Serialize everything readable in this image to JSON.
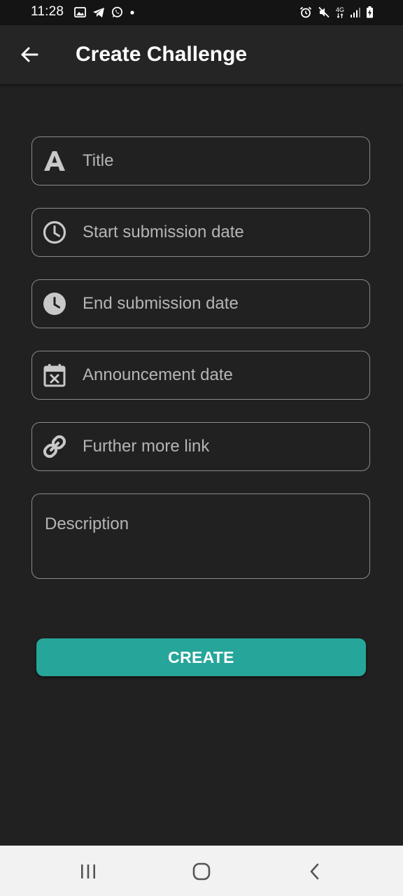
{
  "status_bar": {
    "time": "11:28",
    "left_icons": [
      "gallery-icon",
      "telegram-icon",
      "whatsapp-icon",
      "dot-icon"
    ],
    "network_label_top": "4G",
    "right_icons": [
      "alarm-icon",
      "mute-icon",
      "network-4g-icon",
      "signal-icon",
      "battery-charging-icon"
    ]
  },
  "app_bar": {
    "title": "Create Challenge",
    "back_icon": "arrow-back-icon"
  },
  "form": {
    "fields": [
      {
        "placeholder": "Title",
        "icon": "font-letter-a-icon"
      },
      {
        "placeholder": "Start submission date",
        "icon": "clock-outline-icon"
      },
      {
        "placeholder": "End submission date",
        "icon": "clock-filled-icon"
      },
      {
        "placeholder": "Announcement date",
        "icon": "calendar-x-icon"
      },
      {
        "placeholder": "Further more link",
        "icon": "link-icon"
      }
    ],
    "description_placeholder": "Description"
  },
  "create_button": {
    "label": "CREATE",
    "color": "#26a69a"
  },
  "nav_bar": {
    "buttons": [
      "recent-apps-icon",
      "home-icon",
      "back-nav-icon"
    ]
  },
  "colors": {
    "background": "#212121",
    "app_bar": "#252525",
    "field_border": "#8a8a8a",
    "placeholder_text": "#b5b5b5",
    "accent": "#26a69a",
    "nav_bar": "#f2f2f2"
  }
}
